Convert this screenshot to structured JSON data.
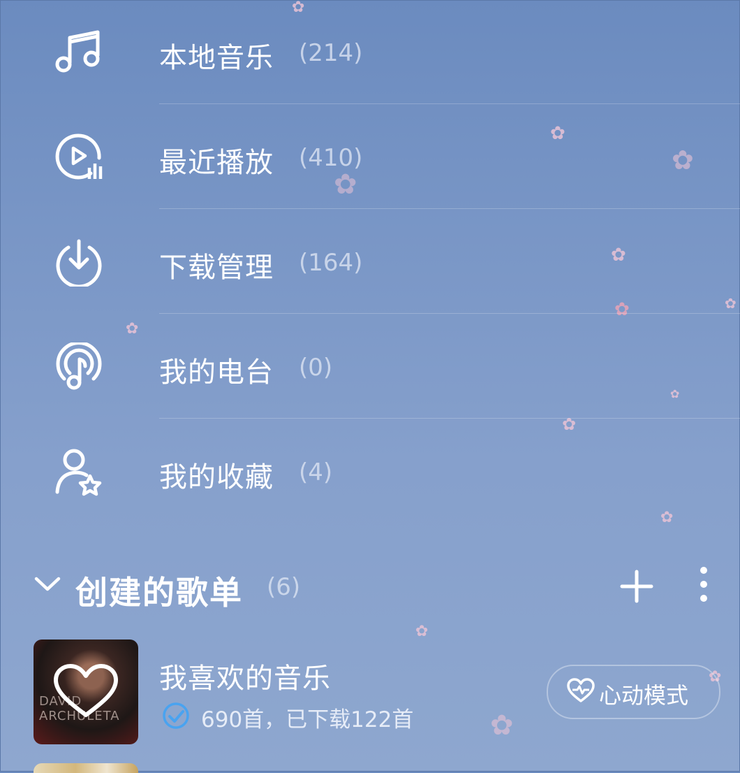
{
  "menu": [
    {
      "label": "本地音乐",
      "count": "(214)",
      "icon": "music-note-icon"
    },
    {
      "label": "最近播放",
      "count": "(410)",
      "icon": "recent-play-icon"
    },
    {
      "label": "下载管理",
      "count": "(164)",
      "icon": "download-icon"
    },
    {
      "label": "我的电台",
      "count": "(0)",
      "icon": "radio-icon"
    },
    {
      "label": "我的收藏",
      "count": "(4)",
      "icon": "favorite-user-icon"
    }
  ],
  "created_playlists": {
    "title": "创建的歌单",
    "count": "(6)",
    "add_icon": "plus-icon",
    "more_icon": "more-vertical-icon",
    "collapse_icon": "chevron-down-icon"
  },
  "playlist": {
    "title": "我喜欢的音乐",
    "subtitle": "690首，已下载122首",
    "cover_text": "DAVID ARCHULETA",
    "heart_mode_label": "心动模式"
  },
  "colors": {
    "background": "#7996c6",
    "text": "#ffffff",
    "count_text": "#d6dff0",
    "check_badge": "#49a3f0"
  }
}
